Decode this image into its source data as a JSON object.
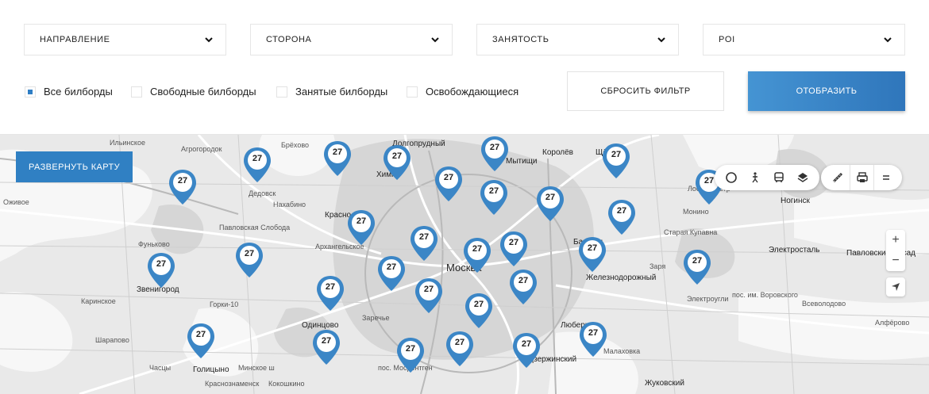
{
  "filters": {
    "direction": "НАПРАВЛЕНИЕ",
    "side": "СТОРОНА",
    "occupancy": "ЗАНЯТОСТЬ",
    "poi": "POI"
  },
  "checkboxes": [
    {
      "label": "Все билборды",
      "checked": true
    },
    {
      "label": "Свободные билборды",
      "checked": false
    },
    {
      "label": "Занятые билборды",
      "checked": false
    },
    {
      "label": "Освобождающиеся",
      "checked": false
    }
  ],
  "buttons": {
    "reset": "СБРОСИТЬ ФИЛЬТР",
    "show": "ОТОБРАЗИТЬ",
    "expand_map": "РАЗВЕРНУТЬ КАРТУ"
  },
  "colors": {
    "accent": "#2f7ec4",
    "pin": "#3b86c6"
  },
  "map": {
    "labels": {
      "moskva": "Москва",
      "khimki": "Химки",
      "dolgoprudny": "Долгопрудный",
      "mytishchi": "Мытищи",
      "korolev": "Королёв",
      "shchelkovo": "Щёлково",
      "losino": "Лосино-Петр",
      "noginsk": "Ногинск",
      "monino": "Монино",
      "staraya_kupavna": "Старая Купавна",
      "elektrostal": "Электросталь",
      "pavlovsky_posad": "Павловский Посад",
      "balashikha": "Балаши",
      "zheleznodorozhny": "Железнодорожный",
      "zarya": "Заря",
      "elektrougli": "Электроугли",
      "vorovskogo": "пос. им. Воровского",
      "vsevolodovo": "Всеволодово",
      "alferovo": "Алфёрово",
      "lyubertsy": "Люберцы",
      "dzerzhinsky": "Дзержинский",
      "malakhovka": "Малаховка",
      "zhukovsky": "Жуковский",
      "mosrentgen": "пос. Мосрентген",
      "odintsovo": "Одинцово",
      "krasnogorsk": "Красно",
      "arkhangelskoe": "Архангельское",
      "zarechye": "Заречье",
      "nakhabino": "Нахабино",
      "dedovsk": "Дедовск",
      "pavlovskaya_sloboda": "Павловская Слобода",
      "zvenigorod": "Звенигород",
      "funkovo": "Фуньково",
      "gorki10": "Горки-10",
      "karinskoe": "Каринское",
      "sharapovo": "Шарапово",
      "chastsy": "Часцы",
      "golitsyno": "Голицыно",
      "minskoe": "Минское ш",
      "krasnoznamensk": "Краснознаменск",
      "kokoshkino": "Кокошкино",
      "agrogorodok": "Агрогородок",
      "brekhovo": "Брёхово",
      "ilyinskoe": "Ильинское",
      "ozhivoe": "Оживое"
    },
    "clusters": [
      {
        "count": "27"
      },
      {
        "count": "27"
      },
      {
        "count": "27"
      },
      {
        "count": "27"
      },
      {
        "count": "27"
      },
      {
        "count": "27"
      },
      {
        "count": "27"
      },
      {
        "count": "27"
      },
      {
        "count": "27"
      },
      {
        "count": "27"
      },
      {
        "count": "27"
      },
      {
        "count": "27"
      },
      {
        "count": "27"
      },
      {
        "count": "27"
      },
      {
        "count": "27"
      },
      {
        "count": "27"
      },
      {
        "count": "27"
      },
      {
        "count": "27"
      },
      {
        "count": "27"
      },
      {
        "count": "27"
      },
      {
        "count": "27"
      },
      {
        "count": "27"
      },
      {
        "count": "27"
      },
      {
        "count": "27"
      },
      {
        "count": "27"
      },
      {
        "count": "27"
      },
      {
        "count": "27"
      },
      {
        "count": "27"
      },
      {
        "count": "27"
      },
      {
        "count": "27"
      }
    ],
    "zoom_in": "+",
    "zoom_out": "−"
  }
}
